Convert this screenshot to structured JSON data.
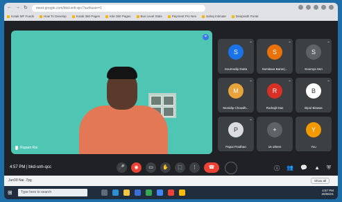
{
  "browser": {
    "url": "meet.google.com/bkd-snh-qcc?authuser=1",
    "bookmarks": [
      "Kotak MF Funds",
      "How To Develop",
      "Kotak 360 Pages",
      "Kite 360 Pages",
      "Bus Level Stats",
      "Payment Pro Nes",
      "Sahaj Intimate",
      "Deepnath Portal"
    ]
  },
  "meeting": {
    "time": "4:57 PM",
    "code": "bkd-snh-qcc",
    "main_speaker": "Rupam Rai"
  },
  "participants": [
    {
      "name": "Soumodip Dutta",
      "avatar_color": "#1a73e8",
      "initial": "S"
    },
    {
      "name": "Sumitava Banerj...",
      "avatar_color": "#e8710a",
      "initial": "S"
    },
    {
      "name": "Soumya Sen",
      "avatar_color": "#5f6368",
      "initial": "S"
    },
    {
      "name": "Monidip Chowdh...",
      "avatar_color": "#e8a33a",
      "initial": "M"
    },
    {
      "name": "Rudrajit Das",
      "avatar_color": "#d93025",
      "initial": "R"
    },
    {
      "name": "Bipul Biswas",
      "avatar_color": "#ffffff",
      "initial": "B"
    },
    {
      "name": "Papai Pradhan",
      "avatar_color": "#dadce0",
      "initial": "P"
    },
    {
      "name": "16 others",
      "avatar_color": "#5f6368",
      "initial": "+"
    },
    {
      "name": "You",
      "avatar_color": "#f29900",
      "initial": "Y"
    }
  ],
  "controls": {
    "mic": "🎤",
    "cam": "◉",
    "captions": "▭",
    "hand": "✋",
    "present": "⬚",
    "more": "⋮",
    "hangup": "☎"
  },
  "right_controls": {
    "info": "ⓘ",
    "people": "👥",
    "chat": "💬",
    "activities": "▲",
    "shield": "⛨"
  },
  "downloads": {
    "item": "Jun09 Nai .7pg",
    "show_all": "Show all"
  },
  "taskbar": {
    "search_placeholder": "Type here to search",
    "time": "4:57 PM",
    "date": "20/06/21"
  }
}
